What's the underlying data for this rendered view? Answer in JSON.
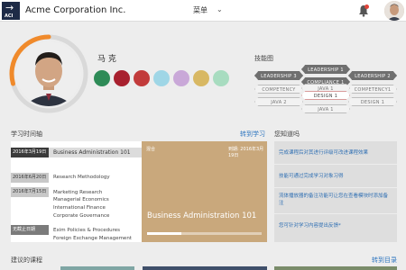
{
  "header": {
    "logo_text": "ACI",
    "company_name": "Acme Corporation Inc.",
    "menu_label": "菜单",
    "menu_icon": "chevron-down-icon",
    "notification_icon": "bell-icon"
  },
  "profile": {
    "name": "马 克",
    "badges": [
      {
        "name": "badge-green",
        "color": "#2e8b57"
      },
      {
        "name": "badge-crimson",
        "color": "#a8202e"
      },
      {
        "name": "badge-trophy",
        "color": "#c23b3b"
      },
      {
        "name": "badge-lightblue",
        "color": "#9fd6e6"
      },
      {
        "name": "badge-lilac",
        "color": "#c9a8d8"
      },
      {
        "name": "badge-gold",
        "color": "#d8b863"
      },
      {
        "name": "badge-mint",
        "color": "#a8dcc0"
      }
    ]
  },
  "skills": {
    "title": "技能图",
    "items": [
      {
        "label": "LEADERSHIP 3",
        "style": "dark"
      },
      {
        "label": "LEADERSHIP 1",
        "style": "dark"
      },
      {
        "label": "LEADERSHIP 2",
        "style": "dark"
      },
      {
        "label": "COMPLIANCE 1",
        "style": "dark"
      },
      {
        "label": "COMPETENCY",
        "style": "outline"
      },
      {
        "label": "COMPETENCY1",
        "style": "outline"
      },
      {
        "label": "JAVA 1",
        "style": "outline"
      },
      {
        "label": "DESIGN 1",
        "style": "highlight"
      },
      {
        "label": "JAVA 2",
        "style": "outline"
      },
      {
        "label": "JAVA 1",
        "style": "outline"
      },
      {
        "label": "DESIGN 1",
        "style": "outline"
      }
    ]
  },
  "timeline": {
    "title": "学习时间轴",
    "link": "转到学习",
    "entries": [
      {
        "date": "2016年3月19日",
        "courses": [
          "Business Administration 101"
        ]
      },
      {
        "date": "",
        "courses": [
          "Research Methodology"
        ]
      },
      {
        "date": "2016年6月20日",
        "courses": []
      },
      {
        "date": "2016年7月15日",
        "courses": [
          "Marketing Research",
          "Managerial Economics",
          "International Finance",
          "Corporate Governance"
        ]
      },
      {
        "date": "无截止日期",
        "courses": [
          "Exim Policies & Procedures",
          "Foreign Exchange Management"
        ]
      }
    ]
  },
  "course_card": {
    "label": "混合",
    "due": "到期: 2016年3月19日",
    "title": "Business Administration 101",
    "progress": 0.3
  },
  "did_you_know": {
    "title": "您知道吗",
    "items": [
      "完成课程后对其进行评级可改进课程效果",
      "技能可通过完成学习对象习得",
      "流体播放器的备注功能可让您在查看模块时添加备注",
      "您可针对学习内容提出反馈*"
    ]
  },
  "suggested": {
    "title": "建议的课程",
    "link": "转到目录",
    "card_colors": [
      "#7fa6a4",
      "#3f4f6a",
      "#7a8c6a"
    ]
  }
}
